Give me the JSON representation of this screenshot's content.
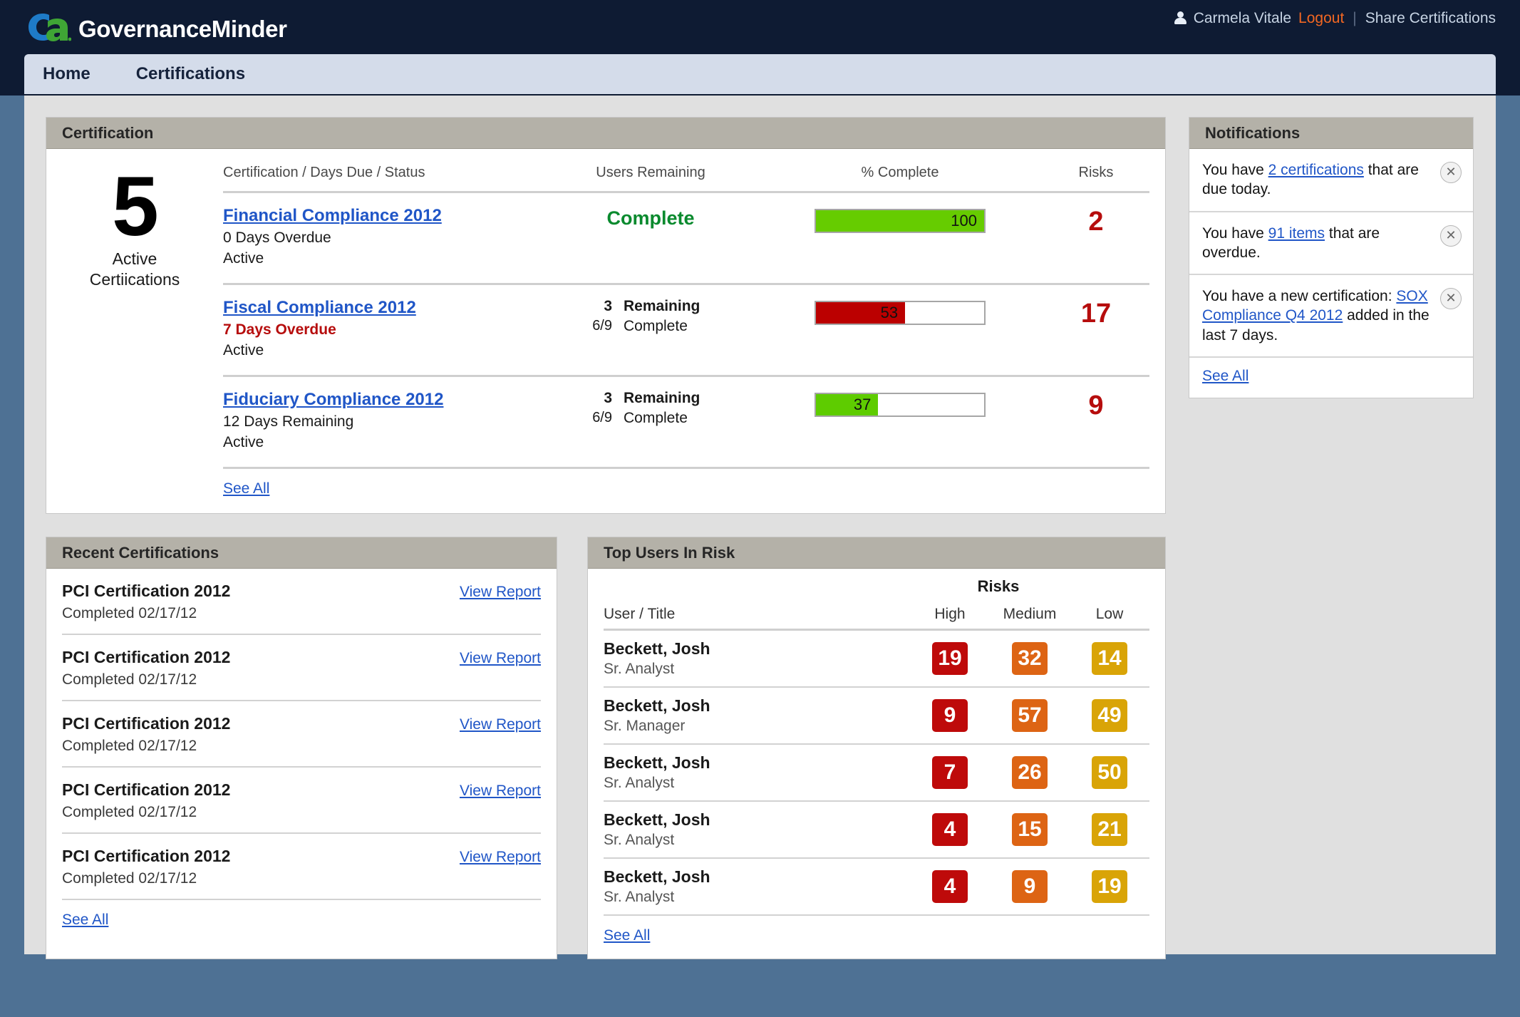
{
  "header": {
    "brand_title": "GovernanceMinder",
    "logo_text": "ca.",
    "user_name": "Carmela Vitale",
    "logout_label": "Logout",
    "share_label": "Share Certifications",
    "separator": "|",
    "colors": {
      "logo_blue": "#1e7bc8",
      "logo_green": "#3fa535",
      "logout_orange": "#f26722",
      "topbar": "#0e1b33"
    }
  },
  "nav": {
    "items": [
      {
        "label": "Home"
      },
      {
        "label": "Certifications"
      }
    ]
  },
  "certification_panel": {
    "title": "Certification",
    "active_count": "5",
    "active_label_line1": "Active",
    "active_label_line2": "Certiications",
    "columns": {
      "name": "Certification / Days Due / Status",
      "users": "Users Remaining",
      "percent": "% Complete",
      "risks": "Risks"
    },
    "see_all": "See All",
    "rows": [
      {
        "name": "Financial Compliance 2012",
        "days": "0 Days Overdue",
        "days_overdue": false,
        "status": "Active",
        "users_complete_text": "Complete",
        "users_remaining": "",
        "users_remaining_label": "",
        "users_completed": "",
        "users_completed_label": "",
        "percent": 100,
        "percent_label": "100",
        "bar_color": "#66cc00",
        "risks": "2"
      },
      {
        "name": "Fiscal Compliance 2012",
        "days": "7 Days Overdue",
        "days_overdue": true,
        "status": "Active",
        "users_complete_text": "",
        "users_remaining": "3",
        "users_remaining_label": "Remaining",
        "users_completed": "6/9",
        "users_completed_label": "Complete",
        "percent": 53,
        "percent_label": "53",
        "bar_color": "#bb0000",
        "risks": "17"
      },
      {
        "name": "Fiduciary Compliance 2012",
        "days": "12 Days Remaining",
        "days_overdue": false,
        "status": "Active",
        "users_complete_text": "",
        "users_remaining": "3",
        "users_remaining_label": "Remaining",
        "users_completed": "6/9",
        "users_completed_label": "Complete",
        "percent": 37,
        "percent_label": "37",
        "bar_color": "#5ecc00",
        "risks": "9"
      }
    ]
  },
  "notifications_panel": {
    "title": "Notifications",
    "see_all": "See All",
    "close_icon": "✕",
    "items": [
      {
        "pre": "You have ",
        "link": "2 certifications",
        "post": " that are due today."
      },
      {
        "pre": "You have ",
        "link": "91 items",
        "post": " that are overdue."
      },
      {
        "pre": "You have a new certification: ",
        "link": "SOX Compliance Q4 2012",
        "post": " added in the last 7 days."
      }
    ]
  },
  "recent_panel": {
    "title": "Recent Certifications",
    "see_all": "See All",
    "action_label": "View Report",
    "items": [
      {
        "name": "PCI Certification 2012",
        "date": "Completed 02/17/12"
      },
      {
        "name": "PCI Certification 2012",
        "date": "Completed 02/17/12"
      },
      {
        "name": "PCI Certification 2012",
        "date": "Completed 02/17/12"
      },
      {
        "name": "PCI Certification 2012",
        "date": "Completed 02/17/12"
      },
      {
        "name": "PCI Certification 2012",
        "date": "Completed 02/17/12"
      }
    ]
  },
  "risk_panel": {
    "title": "Top Users In Risk",
    "group_header": "Risks",
    "columns": {
      "user": "User / Title",
      "high": "High",
      "medium": "Medium",
      "low": "Low"
    },
    "see_all": "See All",
    "colors": {
      "high": "#be0a0a",
      "medium": "#dd6414",
      "low": "#d9a407"
    },
    "rows": [
      {
        "name": "Beckett, Josh",
        "title": "Sr. Analyst",
        "high": "19",
        "medium": "32",
        "low": "14"
      },
      {
        "name": "Beckett, Josh",
        "title": "Sr. Manager",
        "high": "9",
        "medium": "57",
        "low": "49"
      },
      {
        "name": "Beckett, Josh",
        "title": "Sr. Analyst",
        "high": "7",
        "medium": "26",
        "low": "50"
      },
      {
        "name": "Beckett, Josh",
        "title": "Sr. Analyst",
        "high": "4",
        "medium": "15",
        "low": "21"
      },
      {
        "name": "Beckett, Josh",
        "title": "Sr. Analyst",
        "high": "4",
        "medium": "9",
        "low": "19"
      }
    ]
  }
}
